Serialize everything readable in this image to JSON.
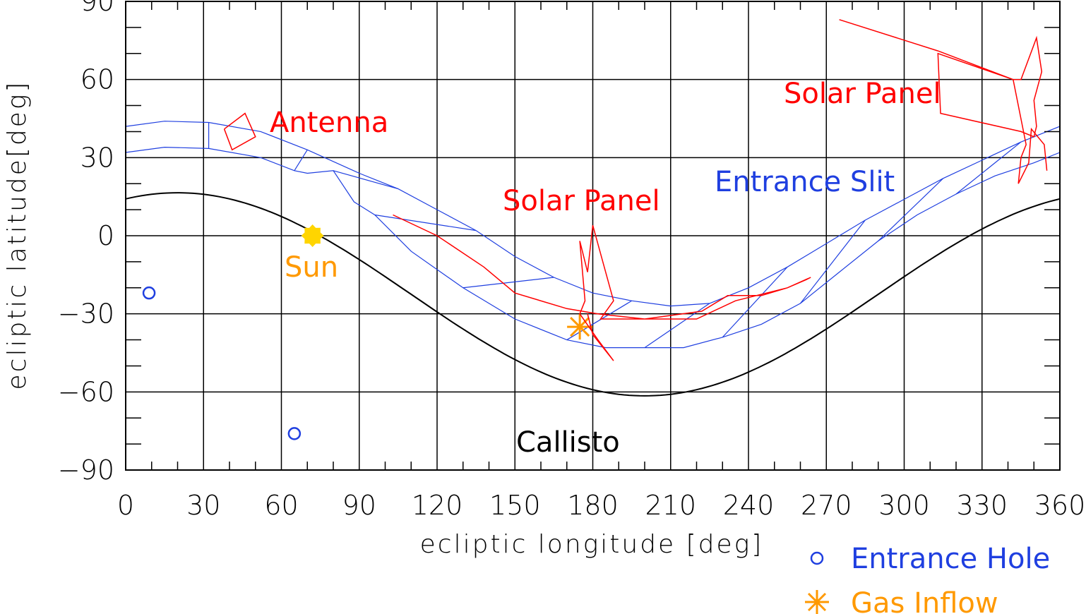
{
  "chart_data": {
    "type": "line",
    "xlabel": "ecliptic longitude [deg]",
    "ylabel": "ecliptic latitude[deg]",
    "xlim": [
      0,
      360
    ],
    "ylim": [
      -90,
      90
    ],
    "xticks": [
      "0",
      "30",
      "60",
      "90",
      "120",
      "150",
      "180",
      "210",
      "240",
      "270",
      "300",
      "330",
      "360"
    ],
    "yticks": [
      "90",
      "60",
      "30",
      "0",
      "−30",
      "−60",
      "−90"
    ],
    "grid": true,
    "colors": {
      "antenna": "#ff0000",
      "solar_panel": "#ff0000",
      "entrance_slit": "#1f3fe0",
      "entrance_hole": "#1f3fe0",
      "sun": "#ffd500",
      "gas_inflow": "#ff9900",
      "callisto": "#000000"
    },
    "annotations": {
      "antenna": "Antenna",
      "solar_panel_1": "Solar Panel",
      "solar_panel_2": "Solar Panel",
      "entrance_slit": "Entrance Slit",
      "sun": "Sun",
      "callisto": "Callisto"
    },
    "legend": {
      "placement": "bottom-right",
      "entries": [
        {
          "label": "Entrance Hole",
          "marker": "circle",
          "color": "#1f3fe0"
        },
        {
          "label": "Gas Inflow",
          "marker": "asterisk",
          "color": "#ff9900"
        }
      ]
    },
    "series": [
      {
        "name": "Callisto",
        "kind": "curve",
        "amplitude": 39,
        "offset": -22.5,
        "peak_longitude": 20
      },
      {
        "name": "Entrance Slit",
        "kind": "band",
        "upper": [
          [
            0,
            42
          ],
          [
            15,
            44
          ],
          [
            32,
            43.5
          ],
          [
            52,
            40
          ],
          [
            70,
            33
          ],
          [
            90,
            24
          ],
          [
            105,
            18
          ],
          [
            120,
            10
          ],
          [
            135,
            2
          ],
          [
            150,
            -8
          ],
          [
            165,
            -16
          ],
          [
            180,
            -22
          ],
          [
            195,
            -25
          ],
          [
            210,
            -27
          ],
          [
            225,
            -26
          ],
          [
            240,
            -20
          ],
          [
            255,
            -12
          ],
          [
            270,
            -3
          ],
          [
            285,
            6
          ],
          [
            300,
            14
          ],
          [
            315,
            22
          ],
          [
            330,
            29
          ],
          [
            345,
            36
          ],
          [
            360,
            42
          ]
        ],
        "lower": [
          [
            0,
            32
          ],
          [
            15,
            34
          ],
          [
            32,
            33.5
          ],
          [
            52,
            30
          ],
          [
            65,
            25
          ],
          [
            70,
            24
          ],
          [
            80,
            25
          ],
          [
            88,
            13
          ],
          [
            96,
            8
          ],
          [
            110,
            -6
          ],
          [
            130,
            -20
          ],
          [
            150,
            -32
          ],
          [
            170,
            -40
          ],
          [
            185,
            -43
          ],
          [
            200,
            -43
          ],
          [
            215,
            -43
          ],
          [
            230,
            -39
          ],
          [
            245,
            -34
          ],
          [
            260,
            -26
          ],
          [
            275,
            -14
          ],
          [
            290,
            -2
          ],
          [
            305,
            8
          ],
          [
            320,
            16
          ],
          [
            335,
            23
          ],
          [
            350,
            28
          ],
          [
            360,
            32
          ]
        ]
      },
      {
        "name": "Entrance Hole",
        "kind": "points",
        "points": [
          [
            9,
            -22
          ],
          [
            65,
            -76
          ]
        ]
      },
      {
        "name": "Sun",
        "kind": "point",
        "points": [
          [
            72,
            0
          ]
        ]
      },
      {
        "name": "Gas Inflow",
        "kind": "point",
        "points": [
          [
            175,
            -35
          ]
        ]
      },
      {
        "name": "Antenna",
        "kind": "polygon",
        "points": [
          [
            38,
            41
          ],
          [
            46,
            47
          ],
          [
            50,
            38
          ],
          [
            41,
            33
          ],
          [
            38,
            41
          ]
        ]
      },
      {
        "name": "Solar Panel",
        "kind": "path",
        "points": [
          [
            103,
            8
          ],
          [
            120,
            0
          ],
          [
            138,
            -12
          ],
          [
            150,
            -22
          ],
          [
            170,
            -28
          ],
          [
            182,
            -30
          ],
          [
            200,
            -32
          ],
          [
            220,
            -32
          ],
          [
            235,
            -25
          ],
          [
            255,
            -20
          ],
          [
            262,
            -17
          ],
          [
            264,
            -16
          ],
          [
            255,
            -20
          ],
          [
            245,
            -23
          ],
          [
            232,
            -23
          ],
          [
            222,
            -29
          ],
          [
            200,
            -32
          ],
          [
            183,
            -32
          ],
          [
            188,
            -25
          ],
          [
            180,
            4
          ],
          [
            178,
            -14
          ],
          [
            176,
            -6
          ],
          [
            175,
            -2
          ],
          [
            177,
            -25
          ],
          [
            175,
            -30
          ],
          [
            182,
            -40
          ],
          [
            188,
            -48
          ],
          [
            180,
            -38
          ],
          [
            178,
            -30
          ]
        ]
      },
      {
        "name": "Solar Panel",
        "kind": "path",
        "points": [
          [
            275,
            83
          ],
          [
            313,
            71
          ],
          [
            342,
            60
          ],
          [
            345,
            60
          ],
          [
            351,
            76
          ],
          [
            353,
            63
          ],
          [
            350,
            52
          ],
          [
            351,
            42
          ],
          [
            350,
            38
          ],
          [
            345,
            40
          ],
          [
            314,
            47
          ],
          [
            313,
            70
          ],
          [
            342,
            60
          ],
          [
            347,
            35
          ],
          [
            345,
            30
          ],
          [
            344,
            20
          ],
          [
            348,
            28
          ],
          [
            349,
            41
          ],
          [
            354,
            35
          ],
          [
            355,
            25
          ]
        ]
      }
    ]
  }
}
